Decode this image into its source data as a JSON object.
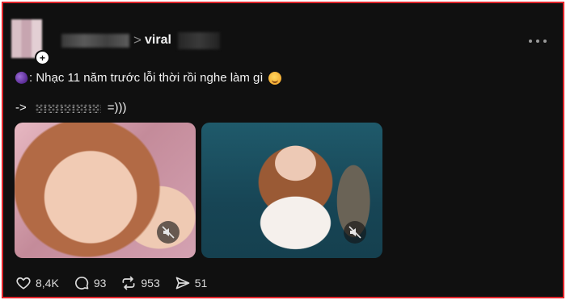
{
  "post": {
    "topic": "viral",
    "chevron": ">",
    "caption_text": ": Nhạc 11 năm trước lỗi thời rồi nghe làm gì",
    "line2_prefix": "->",
    "line2_suffix": "=)))",
    "media": [
      {
        "type": "video",
        "muted": true,
        "icon": "mute-icon"
      },
      {
        "type": "video",
        "muted": true,
        "icon": "mute-icon"
      }
    ]
  },
  "actions": {
    "like_count": "8,4K",
    "comment_count": "93",
    "repost_count": "953",
    "share_count": "51"
  },
  "colors": {
    "frame_border": "#e1252b",
    "background": "#101010",
    "text": "#f3f3f3",
    "muted_text": "#8a8a8a"
  },
  "icons": [
    "verified-plus-icon",
    "more-icon",
    "eggplant-emoji",
    "smile-emoji",
    "mute-icon",
    "heart-icon",
    "comment-icon",
    "repost-icon",
    "share-icon"
  ]
}
